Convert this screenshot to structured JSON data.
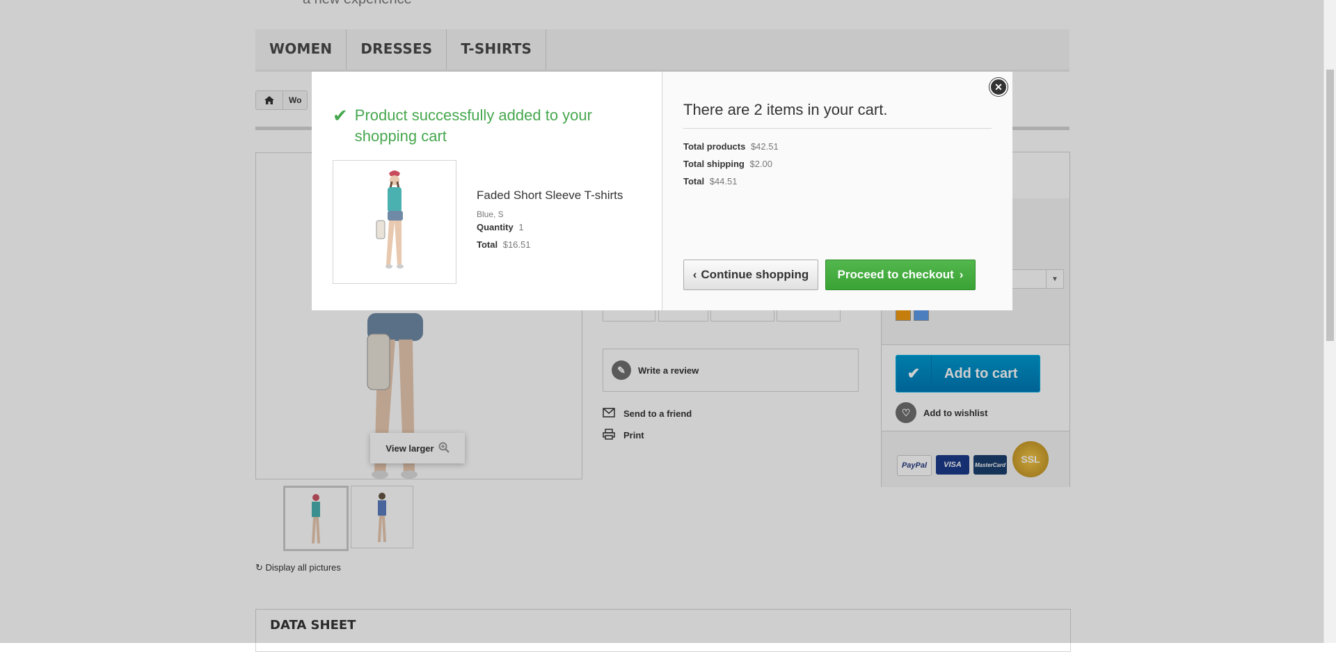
{
  "header": {
    "tagline": "a new experience"
  },
  "topmenu": {
    "items": [
      {
        "label": "WOMEN"
      },
      {
        "label": "DRESSES"
      },
      {
        "label": "T-SHIRTS"
      }
    ]
  },
  "breadcrumb": {
    "crumb": "Wo"
  },
  "product_page": {
    "view_larger": "View larger",
    "display_all": "Display all pictures",
    "write_review": "Write a review",
    "send_friend": "Send to a friend",
    "print": "Print",
    "add_to_cart": "Add to cart",
    "add_wishlist": "Add to wishlist",
    "data_sheet": "DATA SHEET",
    "payment_cards": [
      "PayPal",
      "VISA",
      "MasterCard",
      "SSL"
    ],
    "swatch_colors": [
      "#f39c11",
      "#5d9cec"
    ]
  },
  "modal": {
    "success_message": "Product successfully added to your shopping cart",
    "product": {
      "name": "Faded Short Sleeve T-shirts",
      "attributes": "Blue, S",
      "quantity_label": "Quantity",
      "quantity": "1",
      "total_label": "Total",
      "total": "$16.51"
    },
    "cart": {
      "title": "There are 2 items in your cart.",
      "total_products_label": "Total products",
      "total_products": "$42.51",
      "total_shipping_label": "Total shipping",
      "total_shipping": "$2.00",
      "total_label": "Total",
      "total": "$44.51"
    },
    "continue_label": "Continue shopping",
    "proceed_label": "Proceed to checkout",
    "accent_color": "#46a74e"
  }
}
